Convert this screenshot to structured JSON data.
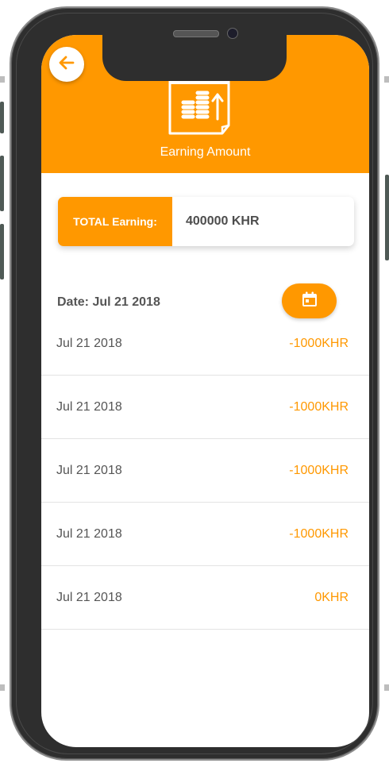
{
  "header": {
    "title": "Earning Amount",
    "back_icon": "arrow-left-icon",
    "hero_icon": "earnings-calendar-coins-icon",
    "color": "#ff9800"
  },
  "summary": {
    "label": "TOTAL Earning:",
    "value": "400000 KHR"
  },
  "filter": {
    "date_label": "Date: Jul 21 2018",
    "calendar_icon": "calendar-icon"
  },
  "transactions": [
    {
      "date": "Jul 21 2018",
      "amount": "-1000KHR"
    },
    {
      "date": "Jul 21 2018",
      "amount": "-1000KHR"
    },
    {
      "date": "Jul 21 2018",
      "amount": "-1000KHR"
    },
    {
      "date": "Jul 21 2018",
      "amount": "-1000KHR"
    },
    {
      "date": "Jul 21 2018",
      "amount": "0KHR"
    }
  ]
}
